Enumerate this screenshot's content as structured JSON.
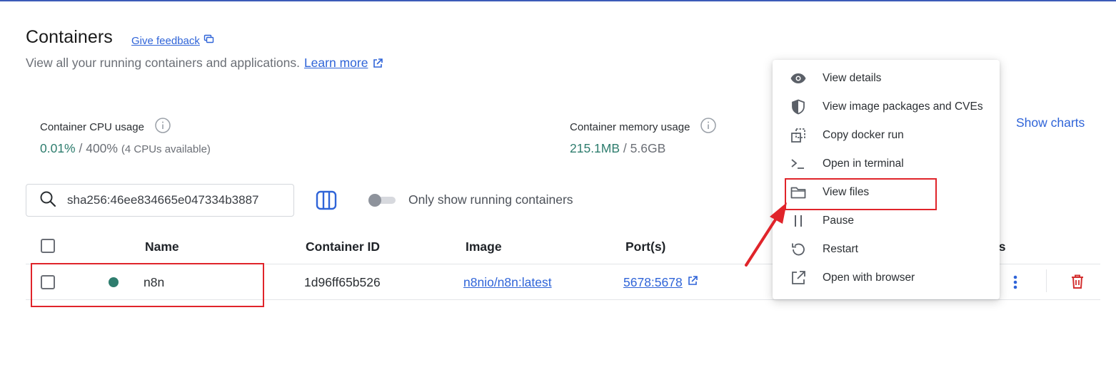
{
  "header": {
    "title": "Containers",
    "feedback_label": "Give feedback",
    "subtitle": "View all your running containers and applications.",
    "learn_more_label": "Learn more"
  },
  "stats": {
    "cpu": {
      "label": "Container CPU usage",
      "used": "0.01%",
      "separator": " / ",
      "total": "400%",
      "note": "(4 CPUs available)"
    },
    "memory": {
      "label": "Container memory usage",
      "used": "215.1MB",
      "separator": " / ",
      "total": "5.6GB"
    },
    "show_charts_label": "Show charts"
  },
  "toolbar": {
    "search_value": "sha256:46ee834665e047334b3887",
    "toggle_label": "Only show running containers",
    "toggle_on": false
  },
  "table": {
    "columns": [
      "Name",
      "Container ID",
      "Image",
      "Port(s)"
    ],
    "actions_header_fragment": "ns",
    "rows": [
      {
        "name": "n8n",
        "container_id": "1d96ff65b526",
        "image": "n8nio/n8n:latest",
        "ports": "5678:5678",
        "status": "running"
      }
    ]
  },
  "context_menu": {
    "items": [
      {
        "label": "View details",
        "icon": "eye-icon"
      },
      {
        "label": "View image packages and CVEs",
        "icon": "shield-icon"
      },
      {
        "label": "Copy docker run",
        "icon": "copy-icon"
      },
      {
        "label": "Open in terminal",
        "icon": "terminal-icon"
      },
      {
        "label": "View files",
        "icon": "folder-icon"
      },
      {
        "label": "Pause",
        "icon": "pause-icon"
      },
      {
        "label": "Restart",
        "icon": "restart-icon"
      },
      {
        "label": "Open with browser",
        "icon": "external-link-icon"
      }
    ]
  },
  "colors": {
    "accent_blue": "#2f64d8",
    "running_green": "#2e7d6e",
    "highlight_red": "#e0242a",
    "delete_red": "#d32f2f"
  }
}
